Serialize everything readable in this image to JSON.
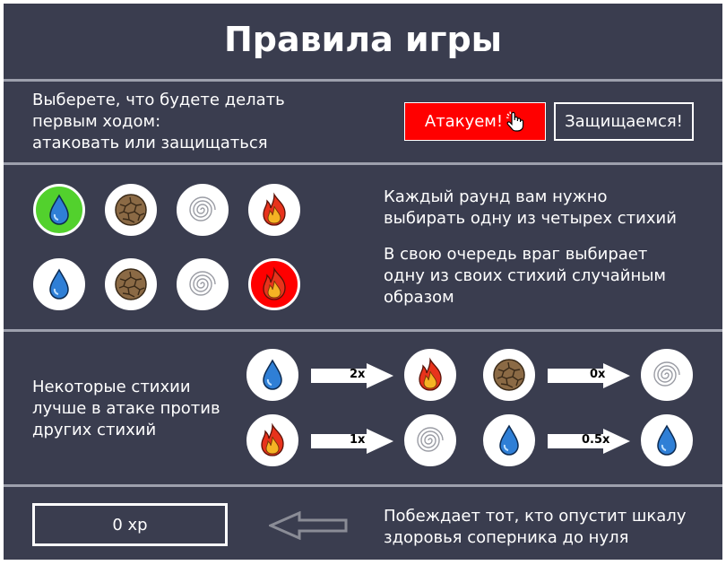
{
  "title": "Правила игры",
  "first_move": {
    "prompt_lines": [
      "Выберете, что будете делать",
      "первым ходом:",
      "атаковать или защищаться"
    ],
    "attack_button": "Атакуем!",
    "defend_button": "Защищаемся!"
  },
  "elements": {
    "player_row": [
      "water",
      "earth",
      "air",
      "fire"
    ],
    "player_selected": "water",
    "enemy_row": [
      "water",
      "earth",
      "air",
      "fire"
    ],
    "enemy_selected": "fire",
    "desc_1_lines": [
      "Каждый раунд вам нужно",
      "выбирать одну из четырех стихий"
    ],
    "desc_2_lines": [
      "В свою очередь враг выбирает",
      "одну из своих стихий случайным",
      "образом"
    ]
  },
  "matchups": {
    "desc_lines": [
      "Некоторые стихии",
      "лучше в атаке против",
      "других стихий"
    ],
    "pairs": [
      {
        "attacker": "water",
        "defender": "fire",
        "multiplier": "2x"
      },
      {
        "attacker": "earth",
        "defender": "air",
        "multiplier": "0x"
      },
      {
        "attacker": "fire",
        "defender": "air",
        "multiplier": "1x"
      },
      {
        "attacker": "water",
        "defender": "water",
        "multiplier": "0.5x"
      }
    ]
  },
  "hp_box": {
    "label": "0 xp"
  },
  "win_condition_lines": [
    "Побеждает тот, кто опустит шкалу",
    "здоровья соперника до нуля"
  ],
  "colors": {
    "background": "#3a3d4f",
    "divider": "#9da0ad",
    "attack_button": "#ff0000",
    "selected_player": "#52d12d",
    "selected_enemy": "#ff0000",
    "water": "#2f7fd6",
    "fire": "#e8331c",
    "earth": "#8b6a45"
  }
}
